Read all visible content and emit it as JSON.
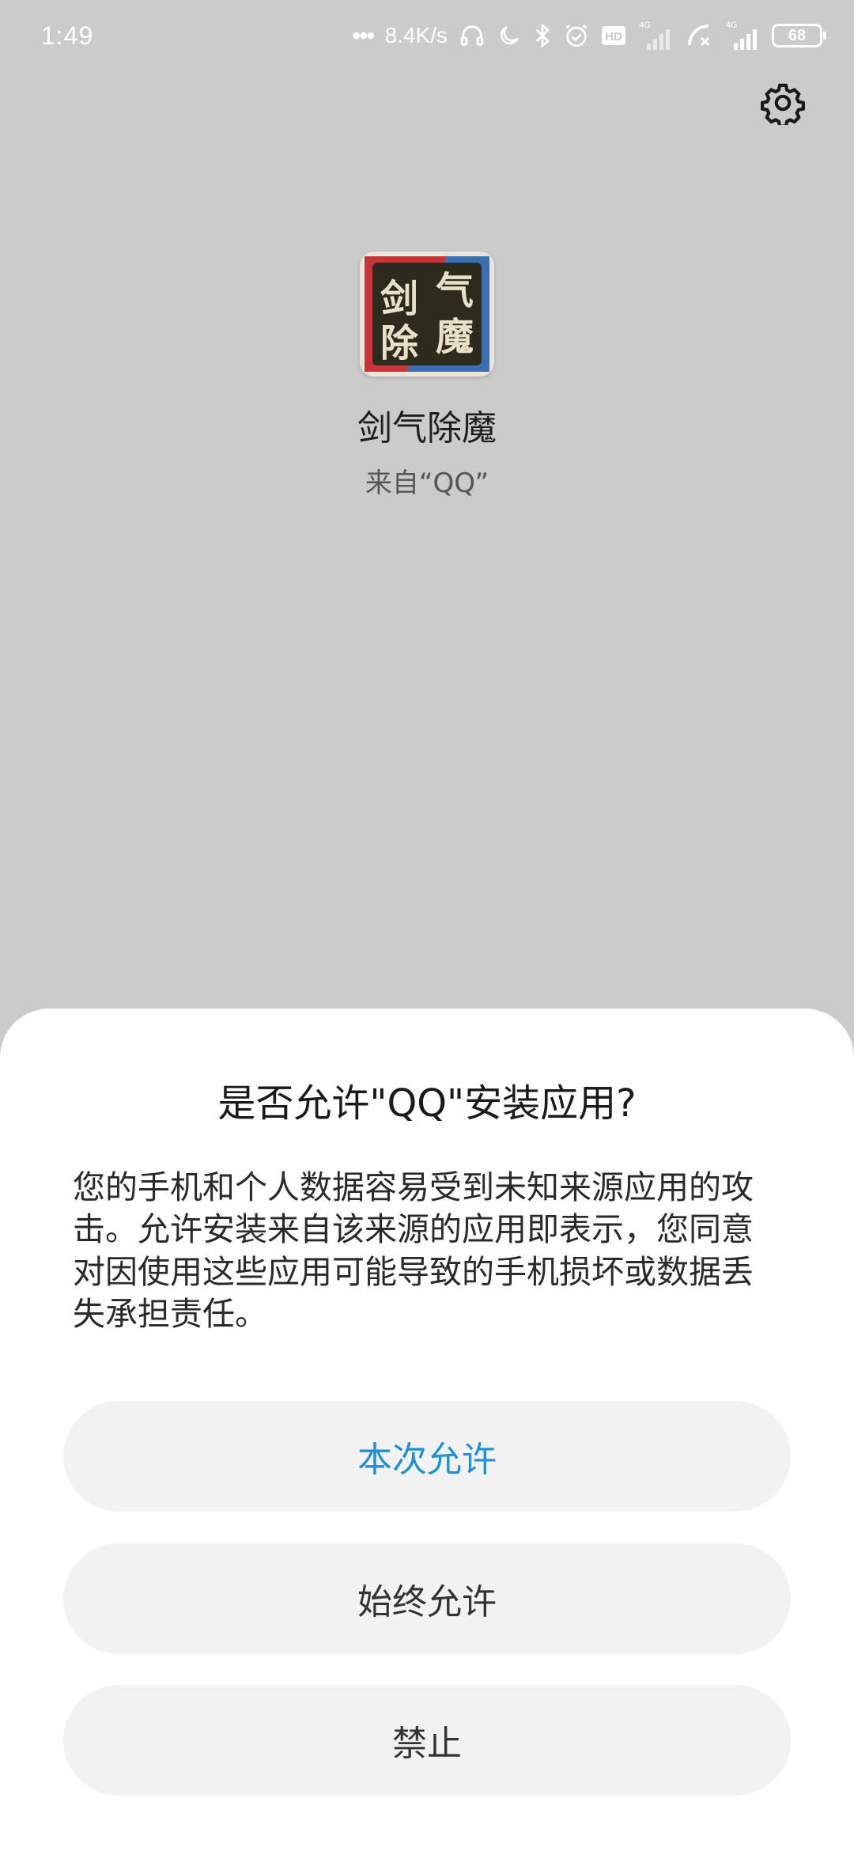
{
  "status_bar": {
    "time": "1:49",
    "network_speed": "8.4K/s",
    "battery_level": "68",
    "hd_label": "HD",
    "network_type_1": "4G",
    "network_type_2": "4G",
    "icons": [
      "more-dots-icon",
      "headphone-icon",
      "moon-icon",
      "bluetooth-icon",
      "alarm-icon",
      "hd-icon",
      "signal-icon",
      "call-forward-icon",
      "signal-icon",
      "battery-icon"
    ]
  },
  "settings": {
    "icon": "gear-icon"
  },
  "app": {
    "name": "剑气除魔",
    "source": "来自“QQ”",
    "icon_chars": [
      "剑",
      "气",
      "除",
      "魔"
    ],
    "icon_colors": {
      "border_red": "#c9343b",
      "border_blue": "#3a6fb4",
      "inner": "#2e2a1e",
      "text": "#e8e0c8"
    }
  },
  "dialog": {
    "title": "是否允许\"QQ\"安装应用?",
    "message": "您的手机和个人数据容易受到未知来源应用的攻击。允许安装来自该来源的应用即表示，您同意对因使用这些应用可能导致的手机损坏或数据丢失承担责任。",
    "buttons": {
      "allow_once": "本次允许",
      "allow_always": "始终允许",
      "deny": "禁止"
    },
    "accent_color": "#1e8fd8"
  }
}
